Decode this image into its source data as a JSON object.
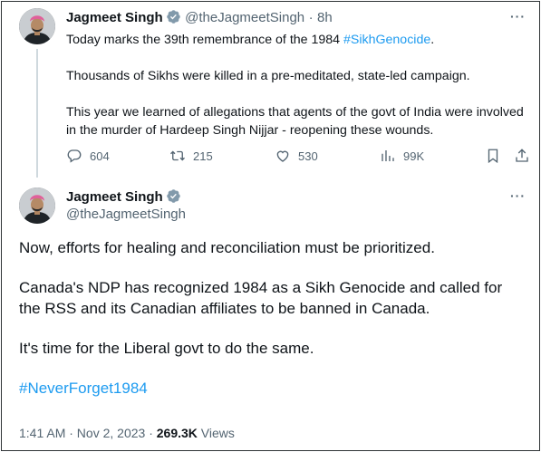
{
  "tweet1": {
    "author_name": "Jagmeet Singh",
    "handle": "@theJagmeetSingh",
    "separator": "·",
    "time": "8h",
    "more": "···",
    "line1_text": "Today marks the 39th remembrance of the 1984 ",
    "line1_hashtag": "#SikhGenocide",
    "line1_end": ".",
    "para2": "Thousands of Sikhs were killed in a pre-meditated, state-led campaign.",
    "para3": "This year we learned of allegations that agents of the govt of India were involved in the murder of Hardeep Singh Nijjar - reopening these wounds.",
    "actions": {
      "replies": "604",
      "reposts": "215",
      "likes": "530",
      "views": "99K"
    }
  },
  "tweet2": {
    "author_name": "Jagmeet Singh",
    "handle": "@theJagmeetSingh",
    "more": "···",
    "para1": "Now, efforts for healing and reconciliation must be prioritized.",
    "para2": "Canada's NDP has recognized 1984 as a Sikh Genocide and called for the RSS and its Canadian affiliates to be banned in Canada.",
    "para3": "It's time for the Liberal govt to do the same.",
    "hashtag": "#NeverForget1984",
    "timestamp": "1:41 AM · Nov 2, 2023 · ",
    "views_count": "269.3K",
    "views_label": " Views"
  },
  "colors": {
    "link": "#1d9bf0",
    "verified": "#829aab",
    "muted": "#536471"
  }
}
